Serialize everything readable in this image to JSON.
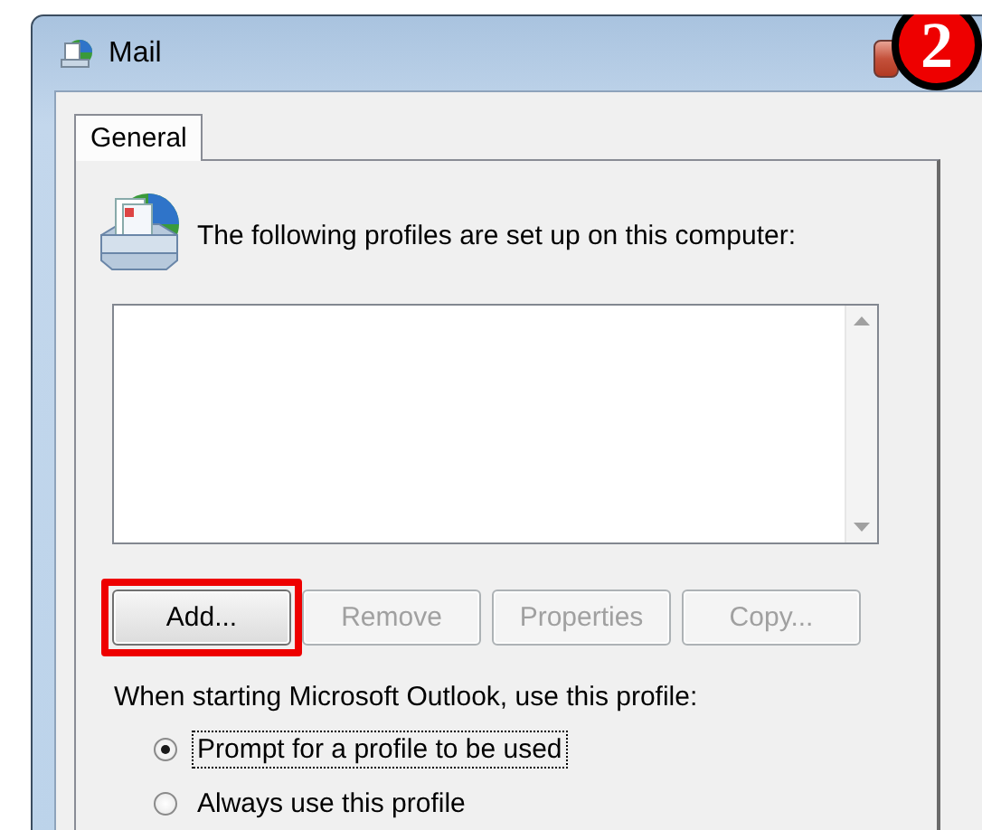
{
  "window": {
    "title": "Mail"
  },
  "tabs": [
    {
      "label": "General",
      "selected": true
    }
  ],
  "intro": "The following profiles are set up on this computer:",
  "buttons": [
    {
      "label": "Add...",
      "disabled": false,
      "highlighted": true
    },
    {
      "label": "Remove",
      "disabled": true,
      "highlighted": false
    },
    {
      "label": "Properties",
      "disabled": true,
      "highlighted": false
    },
    {
      "label": "Copy...",
      "disabled": true,
      "highlighted": false
    }
  ],
  "startup": {
    "label": "When starting Microsoft Outlook, use this profile:",
    "options": [
      {
        "label": "Prompt for a profile to be used",
        "selected": true
      },
      {
        "label": "Always use this profile",
        "selected": false
      }
    ]
  },
  "annotation_badge": "2"
}
